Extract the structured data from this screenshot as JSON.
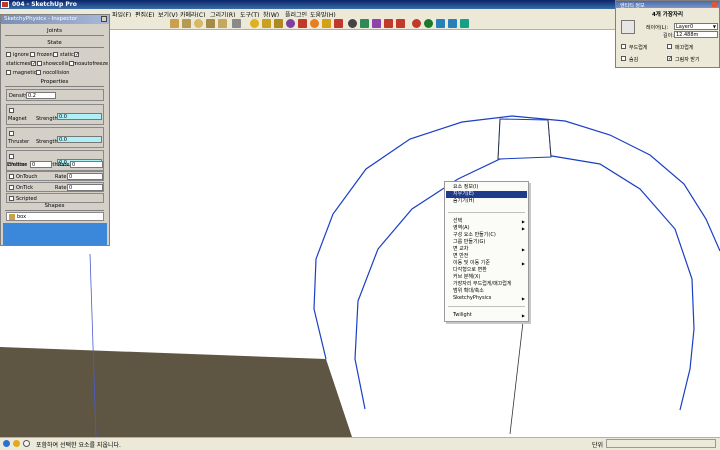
{
  "window": {
    "title": "004 - SketchUp Pro"
  },
  "menubar": {
    "items": [
      "파일(F)",
      "편집(E)",
      "보기(V)",
      "카메라(C)",
      "그리기(R)",
      "도구(T)",
      "창(W)",
      "플러그인",
      "도움말(H)"
    ]
  },
  "physics_panel": {
    "title": "SketchyPhysics - Inspector",
    "joints_header": "Joints",
    "state_header": "State",
    "state_items": [
      {
        "label": "ignore",
        "checked": false
      },
      {
        "label": "frozen",
        "checked": false
      },
      {
        "label": "static",
        "checked": true
      },
      {
        "label": "staticmesh",
        "checked": true
      },
      {
        "label": "showcollision",
        "checked": false
      },
      {
        "label": "noautofreeze",
        "checked": false
      },
      {
        "label": "magnetic",
        "checked": false
      },
      {
        "label": "nocollision",
        "checked": false
      }
    ],
    "properties_header": "Properties",
    "density_label": "Density",
    "density_value": "0.2",
    "magnet_label": "Magnet",
    "strength_label": "Strength",
    "magnet_strength": "0.0",
    "thruster_label": "Thruster",
    "thruster_strength": "0.0",
    "emitter_label": "Emitter",
    "emitter_strength": "0.0",
    "lifetime_label": "Lifetime",
    "lifetime_value": "0",
    "rate_label": "Rate",
    "emitter_rate": "0",
    "ontouch_label": "OnTouch",
    "ontouch_rate": "0",
    "ontick_label": "OnTick",
    "ontick_rate": "0",
    "scripted_label": "Scripted",
    "shapes_header": "Shapes",
    "shape_value": "box"
  },
  "layer_panel": {
    "header": "엔티티 정보",
    "subtitle": "4개 가장자리",
    "layer_label": "레이어(L):",
    "layer_value": "Layer0",
    "length_label": "길이:",
    "length_value": "12.488m",
    "checkboxes": [
      {
        "label": "부드럽게",
        "checked": false
      },
      {
        "label": "매끄럽게",
        "checked": false
      },
      {
        "label": "숨김",
        "checked": false
      },
      {
        "label": "그림자 받기",
        "checked": true
      }
    ]
  },
  "context_menu": {
    "items": [
      {
        "label": "요소 정보(I)",
        "submenu": false,
        "selected": false
      },
      {
        "label": "지우기(E)",
        "submenu": false,
        "selected": true
      },
      {
        "label": "숨기기(H)",
        "submenu": false,
        "selected": false
      },
      {
        "label": "선택",
        "submenu": true,
        "selected": false
      },
      {
        "label": "영역(A)",
        "submenu": true,
        "selected": false
      },
      {
        "label": "구성 요소 만들기(C)",
        "submenu": false,
        "selected": false
      },
      {
        "label": "그룹 만들기(G)",
        "submenu": false,
        "selected": false
      },
      {
        "label": "면 교차",
        "submenu": true,
        "selected": false
      },
      {
        "label": "면 반전",
        "submenu": false,
        "selected": false
      },
      {
        "label": "이동 및 이동 기준",
        "submenu": true,
        "selected": false
      },
      {
        "label": "다각형으로 변환",
        "submenu": false,
        "selected": false
      },
      {
        "label": "커브 분해(X)",
        "submenu": false,
        "selected": false
      },
      {
        "label": "가장자리 부드럽게/매끄럽게",
        "submenu": false,
        "selected": false
      },
      {
        "label": "범위 확대/축소",
        "submenu": false,
        "selected": false
      },
      {
        "label": "SketchyPhysics",
        "submenu": true,
        "selected": false
      },
      {
        "label": "Twilight",
        "submenu": true,
        "selected": false
      }
    ]
  },
  "status": {
    "message": "포함하여 선택한 요소를 지웁니다.",
    "measure_label": "단위"
  },
  "colors": {
    "accent": "#1f3b8a",
    "edge": "#1a3fc4",
    "ground": "#5e5542",
    "panel_blue": "#3b87d9"
  }
}
